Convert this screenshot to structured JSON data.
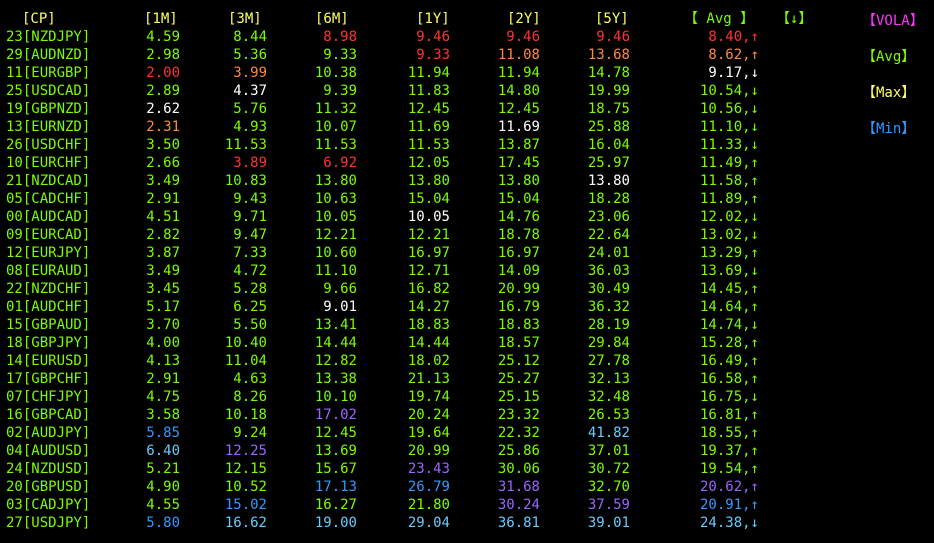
{
  "colors": {
    "green": "#7CFC00",
    "white": "#FFFFFF",
    "yellow": "#FFFF66",
    "red": "#FF3333",
    "orange": "#FF8844",
    "purple": "#9966FF",
    "blue": "#3399FF",
    "cyan": "#66CCFF",
    "magenta": "#FF33FF",
    "legend_blue": "#3399FF"
  },
  "header": {
    "cp": "[CP]",
    "m1": "[1M]",
    "m3": "[3M]",
    "m6": "[6M]",
    "y1": "[1Y]",
    "y2": "[2Y]",
    "y5": "[5Y]",
    "avg": "【 Avg 】",
    "sort": "【↓】"
  },
  "legend": {
    "vola": "【VOLA】",
    "avg": "【Avg】",
    "max": "【Max】",
    "min": "【Min】"
  },
  "rows": [
    {
      "cp": "23[NZDJPY]",
      "v": [
        "4.59",
        "8.44",
        "8.98",
        "9.46",
        "9.46",
        "9.46",
        "8.40,↑"
      ],
      "c": [
        "green",
        "green",
        "red",
        "red",
        "red",
        "red",
        "red"
      ]
    },
    {
      "cp": "29[AUDNZD]",
      "v": [
        "2.98",
        "5.36",
        "9.33",
        "9.33",
        "11.08",
        "13.68",
        "8.62,↑"
      ],
      "c": [
        "green",
        "green",
        "green",
        "red",
        "orange",
        "orange",
        "orange"
      ]
    },
    {
      "cp": "11[EURGBP]",
      "v": [
        "2.00",
        "3.99",
        "10.38",
        "11.94",
        "11.94",
        "14.78",
        "9.17,↓"
      ],
      "c": [
        "red",
        "orange",
        "green",
        "green",
        "green",
        "green",
        "white"
      ]
    },
    {
      "cp": "25[USDCAD]",
      "v": [
        "2.89",
        "4.37",
        "9.39",
        "11.83",
        "14.80",
        "19.99",
        "10.54,↓"
      ],
      "c": [
        "green",
        "white",
        "green",
        "green",
        "green",
        "green",
        "green"
      ]
    },
    {
      "cp": "19[GBPNZD]",
      "v": [
        "2.62",
        "5.76",
        "11.32",
        "12.45",
        "12.45",
        "18.75",
        "10.56,↓"
      ],
      "c": [
        "white",
        "green",
        "green",
        "green",
        "green",
        "green",
        "green"
      ]
    },
    {
      "cp": "13[EURNZD]",
      "v": [
        "2.31",
        "4.93",
        "10.07",
        "11.69",
        "11.69",
        "25.88",
        "11.10,↓"
      ],
      "c": [
        "orange",
        "green",
        "green",
        "green",
        "white",
        "green",
        "green"
      ]
    },
    {
      "cp": "26[USDCHF]",
      "v": [
        "3.50",
        "11.53",
        "11.53",
        "11.53",
        "13.87",
        "16.04",
        "11.33,↓"
      ],
      "c": [
        "green",
        "green",
        "green",
        "green",
        "green",
        "green",
        "green"
      ]
    },
    {
      "cp": "10[EURCHF]",
      "v": [
        "2.66",
        "3.89",
        "6.92",
        "12.05",
        "17.45",
        "25.97",
        "11.49,↑"
      ],
      "c": [
        "green",
        "red",
        "red",
        "green",
        "green",
        "green",
        "green"
      ]
    },
    {
      "cp": "21[NZDCAD]",
      "v": [
        "3.49",
        "10.83",
        "13.80",
        "13.80",
        "13.80",
        "13.80",
        "11.58,↑"
      ],
      "c": [
        "green",
        "green",
        "green",
        "green",
        "green",
        "white",
        "green"
      ]
    },
    {
      "cp": "05[CADCHF]",
      "v": [
        "2.91",
        "9.43",
        "10.63",
        "15.04",
        "15.04",
        "18.28",
        "11.89,↑"
      ],
      "c": [
        "green",
        "green",
        "green",
        "green",
        "green",
        "green",
        "green"
      ]
    },
    {
      "cp": "00[AUDCAD]",
      "v": [
        "4.51",
        "9.71",
        "10.05",
        "10.05",
        "14.76",
        "23.06",
        "12.02,↓"
      ],
      "c": [
        "green",
        "green",
        "green",
        "white",
        "green",
        "green",
        "green"
      ]
    },
    {
      "cp": "09[EURCAD]",
      "v": [
        "2.82",
        "9.47",
        "12.21",
        "12.21",
        "18.78",
        "22.64",
        "13.02,↓"
      ],
      "c": [
        "green",
        "green",
        "green",
        "green",
        "green",
        "green",
        "green"
      ]
    },
    {
      "cp": "12[EURJPY]",
      "v": [
        "3.87",
        "7.33",
        "10.60",
        "16.97",
        "16.97",
        "24.01",
        "13.29,↑"
      ],
      "c": [
        "green",
        "green",
        "green",
        "green",
        "green",
        "green",
        "green"
      ]
    },
    {
      "cp": "08[EURAUD]",
      "v": [
        "3.49",
        "4.72",
        "11.10",
        "12.71",
        "14.09",
        "36.03",
        "13.69,↓"
      ],
      "c": [
        "green",
        "green",
        "green",
        "green",
        "green",
        "green",
        "green"
      ]
    },
    {
      "cp": "22[NZDCHF]",
      "v": [
        "3.45",
        "5.28",
        "9.66",
        "16.82",
        "20.99",
        "30.49",
        "14.45,↑"
      ],
      "c": [
        "green",
        "green",
        "green",
        "green",
        "green",
        "green",
        "green"
      ]
    },
    {
      "cp": "01[AUDCHF]",
      "v": [
        "5.17",
        "6.25",
        "9.01",
        "14.27",
        "16.79",
        "36.32",
        "14.64,↑"
      ],
      "c": [
        "green",
        "green",
        "white",
        "green",
        "green",
        "green",
        "green"
      ]
    },
    {
      "cp": "15[GBPAUD]",
      "v": [
        "3.70",
        "5.50",
        "13.41",
        "18.83",
        "18.83",
        "28.19",
        "14.74,↓"
      ],
      "c": [
        "green",
        "green",
        "green",
        "green",
        "green",
        "green",
        "green"
      ]
    },
    {
      "cp": "18[GBPJPY]",
      "v": [
        "4.00",
        "10.40",
        "14.44",
        "14.44",
        "18.57",
        "29.84",
        "15.28,↑"
      ],
      "c": [
        "green",
        "green",
        "green",
        "green",
        "green",
        "green",
        "green"
      ]
    },
    {
      "cp": "14[EURUSD]",
      "v": [
        "4.13",
        "11.04",
        "12.82",
        "18.02",
        "25.12",
        "27.78",
        "16.49,↑"
      ],
      "c": [
        "green",
        "green",
        "green",
        "green",
        "green",
        "green",
        "green"
      ]
    },
    {
      "cp": "17[GBPCHF]",
      "v": [
        "2.91",
        "4.63",
        "13.38",
        "21.13",
        "25.27",
        "32.13",
        "16.58,↑"
      ],
      "c": [
        "green",
        "green",
        "green",
        "green",
        "green",
        "green",
        "green"
      ]
    },
    {
      "cp": "07[CHFJPY]",
      "v": [
        "4.75",
        "8.26",
        "10.10",
        "19.74",
        "25.15",
        "32.48",
        "16.75,↓"
      ],
      "c": [
        "green",
        "green",
        "green",
        "green",
        "green",
        "green",
        "green"
      ]
    },
    {
      "cp": "16[GBPCAD]",
      "v": [
        "3.58",
        "10.18",
        "17.02",
        "20.24",
        "23.32",
        "26.53",
        "16.81,↑"
      ],
      "c": [
        "green",
        "green",
        "purple",
        "green",
        "green",
        "green",
        "green"
      ]
    },
    {
      "cp": "02[AUDJPY]",
      "v": [
        "5.85",
        "9.24",
        "12.45",
        "19.64",
        "22.32",
        "41.82",
        "18.55,↑"
      ],
      "c": [
        "blue",
        "green",
        "green",
        "green",
        "green",
        "cyan",
        "green"
      ]
    },
    {
      "cp": "04[AUDUSD]",
      "v": [
        "6.40",
        "12.25",
        "13.69",
        "20.99",
        "25.86",
        "37.01",
        "19.37,↑"
      ],
      "c": [
        "cyan",
        "purple",
        "green",
        "green",
        "green",
        "green",
        "green"
      ]
    },
    {
      "cp": "24[NZDUSD]",
      "v": [
        "5.21",
        "12.15",
        "15.67",
        "23.43",
        "30.06",
        "30.72",
        "19.54,↑"
      ],
      "c": [
        "green",
        "green",
        "green",
        "purple",
        "green",
        "green",
        "green"
      ]
    },
    {
      "cp": "20[GBPUSD]",
      "v": [
        "4.90",
        "10.52",
        "17.13",
        "26.79",
        "31.68",
        "32.70",
        "20.62,↑"
      ],
      "c": [
        "green",
        "green",
        "blue",
        "blue",
        "purple",
        "green",
        "purple"
      ]
    },
    {
      "cp": "03[CADJPY]",
      "v": [
        "4.55",
        "15.02",
        "16.27",
        "21.80",
        "30.24",
        "37.59",
        "20.91,↑"
      ],
      "c": [
        "green",
        "blue",
        "green",
        "green",
        "purple",
        "purple",
        "blue"
      ]
    },
    {
      "cp": "27[USDJPY]",
      "v": [
        "5.80",
        "16.62",
        "19.00",
        "29.04",
        "36.81",
        "39.01",
        "24.38,↓"
      ],
      "c": [
        "blue",
        "cyan",
        "cyan",
        "cyan",
        "cyan",
        "cyan",
        "cyan"
      ]
    }
  ]
}
